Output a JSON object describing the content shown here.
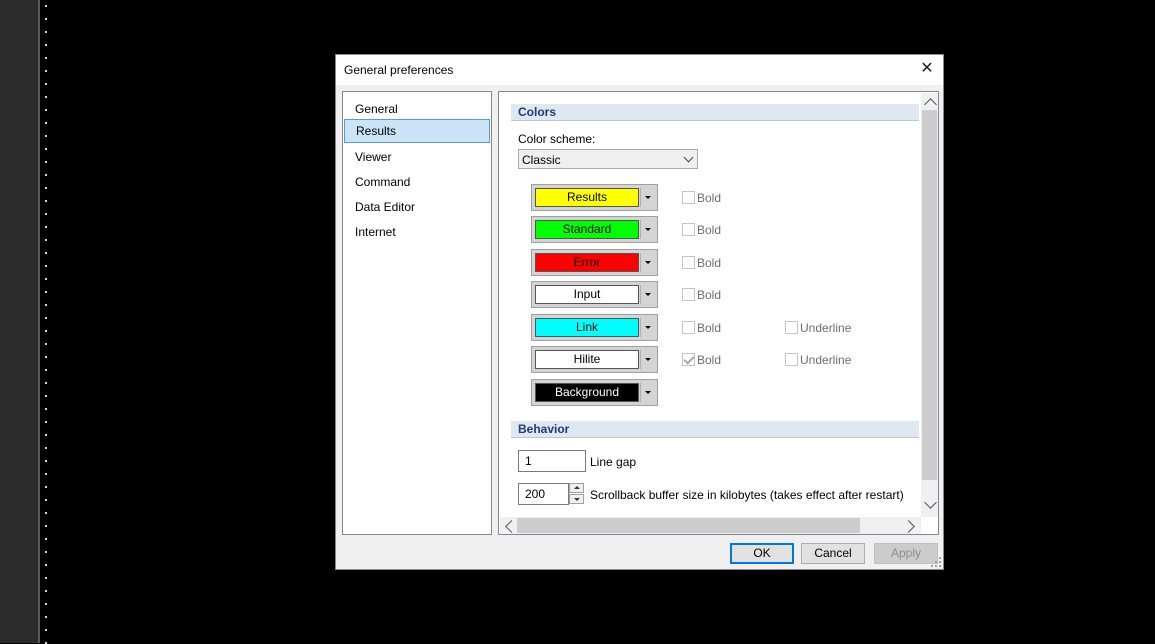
{
  "window": {
    "title": "General preferences"
  },
  "nav": {
    "items": [
      {
        "label": "General"
      },
      {
        "label": "Results"
      },
      {
        "label": "Viewer"
      },
      {
        "label": "Command"
      },
      {
        "label": "Data Editor"
      },
      {
        "label": "Internet"
      }
    ],
    "selected": "Results"
  },
  "colors": {
    "header": "Colors",
    "scheme_label": "Color scheme:",
    "scheme_value": "Classic",
    "rows": [
      {
        "label": "Results",
        "bg": "#ffff00",
        "fg": "#000000",
        "bold_label": "Bold",
        "bold": false
      },
      {
        "label": "Standard",
        "bg": "#00ff00",
        "fg": "#000000",
        "bold_label": "Bold",
        "bold": false
      },
      {
        "label": "Error",
        "bg": "#ff0000",
        "fg": "#000000",
        "bold_label": "Bold",
        "bold": false
      },
      {
        "label": "Input",
        "bg": "#ffffff",
        "fg": "#000000",
        "bold_label": "Bold",
        "bold": false
      },
      {
        "label": "Link",
        "bg": "#00ffff",
        "fg": "#000000",
        "bold_label": "Bold",
        "bold": false,
        "underline_label": "Underline",
        "underline": false
      },
      {
        "label": "Hilite",
        "bg": "#ffffff",
        "fg": "#000000",
        "bold_label": "Bold",
        "bold": true,
        "underline_label": "Underline",
        "underline": false
      },
      {
        "label": "Background",
        "bg": "#000000",
        "fg": "#ffffff"
      }
    ]
  },
  "behavior": {
    "header": "Behavior",
    "line_gap_value": "1",
    "line_gap_label": "Line gap",
    "scrollback_value": "200",
    "scrollback_label": "Scrollback buffer size in kilobytes (takes effect after restart)"
  },
  "buttons": {
    "ok": "OK",
    "cancel": "Cancel",
    "apply": "Apply"
  },
  "icons": {
    "close": "close-icon",
    "chevron": "chevron-down-icon"
  }
}
